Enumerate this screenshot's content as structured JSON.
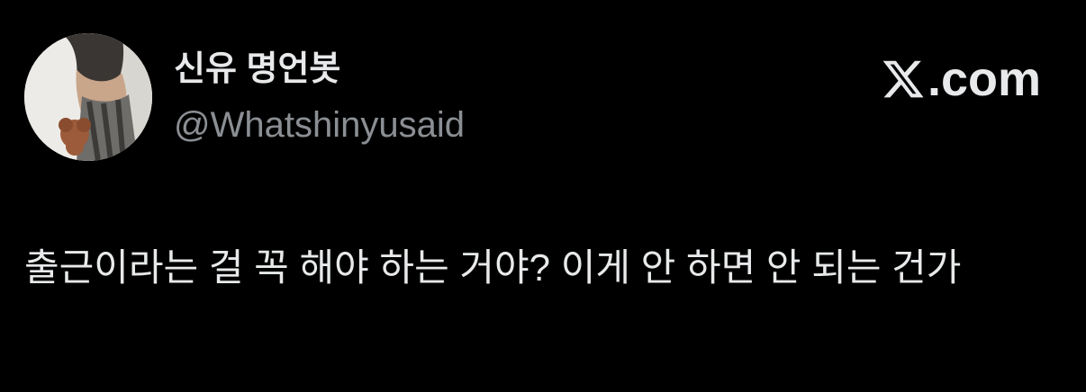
{
  "author": {
    "display_name": "신유 명언봇",
    "handle": "@Whatshinyusaid",
    "avatar_icon": "profile-photo-avatar"
  },
  "brand": {
    "logo_icon": "x-logo-icon",
    "domain": ".com"
  },
  "tweet": {
    "text": "출근이라는 걸 꼭 해야 하는 거야? 이게 안 하면 안 되는 건가"
  },
  "colors": {
    "background": "#000000",
    "primary_text": "#e7e9ea",
    "secondary_text": "#8b8f94"
  }
}
